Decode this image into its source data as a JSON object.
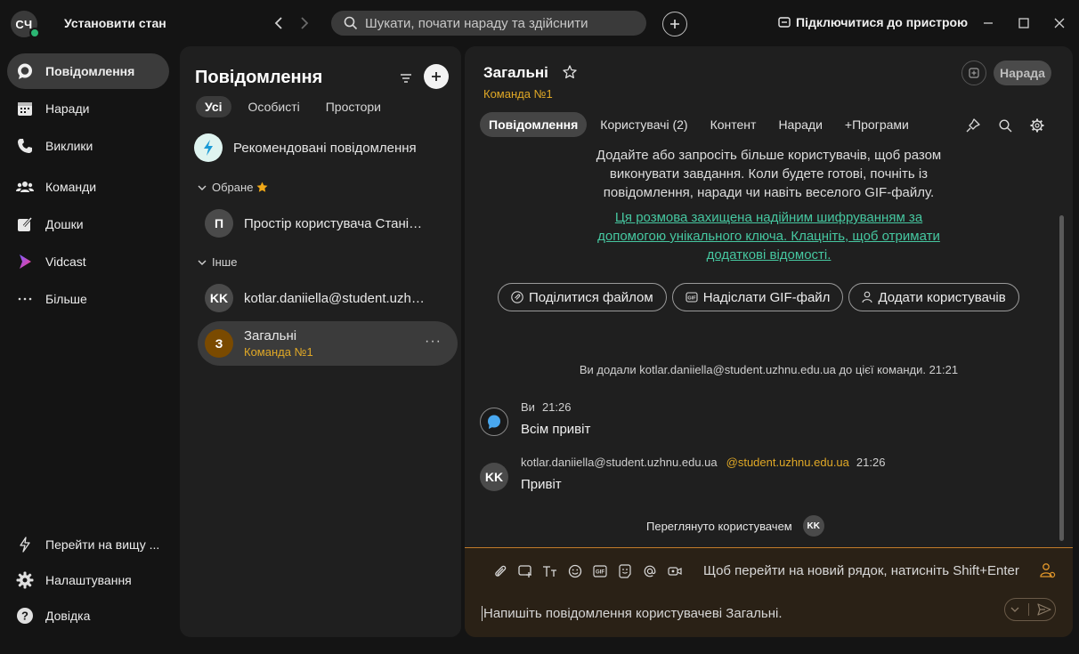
{
  "topbar": {
    "avatar_initials": "СЧ",
    "status_label": "Установити стан",
    "search_placeholder": "Шукати, почати нараду та здійснити",
    "connect_label": "Підключитися до пристрою"
  },
  "leftnav": {
    "items": [
      {
        "label": "Повідомлення",
        "icon": "chat-bubble-icon",
        "active": true
      },
      {
        "label": "Наради",
        "icon": "calendar-icon"
      },
      {
        "label": "Виклики",
        "icon": "phone-icon"
      },
      {
        "label": "Команди",
        "icon": "team-icon"
      },
      {
        "label": "Дошки",
        "icon": "whiteboard-icon"
      },
      {
        "label": "Vidcast",
        "icon": "vidcast-icon"
      },
      {
        "label": "Більше",
        "icon": "more-icon"
      }
    ],
    "bottom": [
      {
        "label": "Перейти на вищу ...",
        "icon": "lightning-icon"
      },
      {
        "label": "Налаштування",
        "icon": "gear-icon"
      },
      {
        "label": "Довідка",
        "icon": "help-icon"
      }
    ]
  },
  "list": {
    "title": "Повідомлення",
    "tabs": [
      "Усі",
      "Особисті",
      "Простори"
    ],
    "recommended": "Рекомендовані повідомлення",
    "favorites_header": "Обране",
    "other_header": "Інше",
    "conversations": [
      {
        "initials": "П",
        "name": "Простір користувача Стані…"
      },
      {
        "initials": "KK",
        "name": "kotlar.daniiella@student.uzh…"
      },
      {
        "initials": "З",
        "name": "Загальні",
        "sub": "Команда №1"
      }
    ]
  },
  "main": {
    "title": "Загальні",
    "subtitle": "Команда №1",
    "meet_button": "Нарада",
    "tabs": [
      "Повідомлення",
      "Користувачі (2)",
      "Контент",
      "Наради",
      "+Програми"
    ],
    "info_lines": [
      "Додайте або запросіть більше користувачів, щоб разом",
      "виконувати завдання. Коли будете готові, почніть із",
      "повідомлення, наради чи навіть веселого GIF-файлу."
    ],
    "secure_lines": [
      "Ця розмова захищена надійним шифруванням за",
      "допомогою унікального ключа. Клацніть, щоб отримати",
      "додаткові відомості."
    ],
    "actions": [
      "Поділитися файлом",
      "Надіслати GIF-файл",
      "Додати користувачів"
    ],
    "system_message": "Ви додали kotlar.daniiella@student.uzhnu.edu.ua до цієї команди. 21:21",
    "messages": [
      {
        "sender": "Ви",
        "time": "21:26",
        "text": "Всім привіт"
      },
      {
        "sender": "kotlar.daniiella@student.uzhnu.edu.ua",
        "mention": "@student.uzhnu.edu.ua",
        "time": "21:26",
        "text": "Привіт",
        "initials": "KK"
      }
    ],
    "seen_label": "Переглянуто користувачем",
    "seen_initials": "KK",
    "composer": {
      "hint": "Щоб перейти на новий рядок, натисніть Shift+Enter",
      "placeholder": "Напишіть повідомлення користувачеві Загальні."
    }
  },
  "colors": {
    "accent_orange": "#e0a826",
    "link_green": "#46c7a0",
    "presence_green": "#2bb673"
  }
}
